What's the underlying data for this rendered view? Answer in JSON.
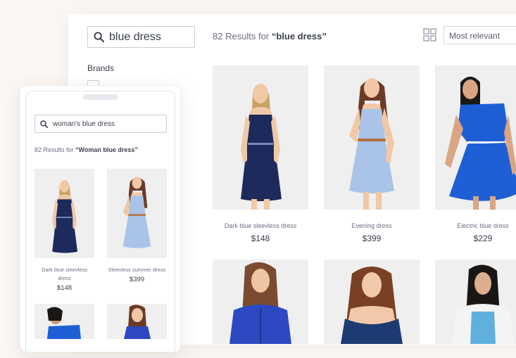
{
  "search": {
    "value": "blue dress"
  },
  "results": {
    "count_prefix": "82 Results for ",
    "query": "“blue dress”"
  },
  "sort": {
    "selected": "Most relevant"
  },
  "filters": {
    "brands_label": "Brands"
  },
  "products": [
    {
      "name": "Dark blue sleevless dress",
      "price": "$148"
    },
    {
      "name": "Evening dress",
      "price": "$399"
    },
    {
      "name": "Electric blue dress",
      "price": "$229"
    }
  ],
  "mobile": {
    "search_value": "woman's blue dress",
    "results_prefix": "82 Results for ",
    "results_query": "“Woman blue dress”",
    "products": [
      {
        "name": "Dark blue sleevless dress",
        "price": "$148"
      },
      {
        "name": "Sleevless summer dress",
        "price": "$399"
      }
    ]
  },
  "colors": {
    "navy_dress": "#1d2a5c",
    "light_blue_dress": "#a9c4e8",
    "electric_blue": "#1f5fd6",
    "photo_bg": "#efefef"
  }
}
